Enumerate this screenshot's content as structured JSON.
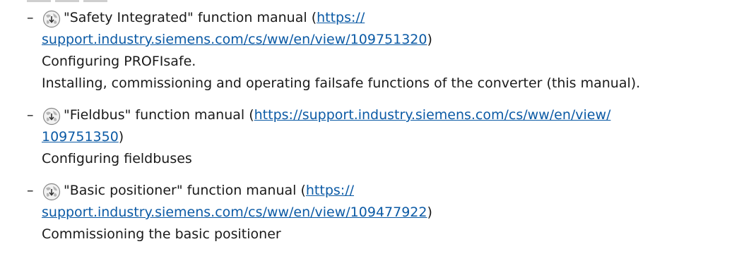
{
  "items": [
    {
      "icon": "globe-download-icon",
      "title": "\"Safety Integrated\" function manual",
      "url_a": "https://",
      "url_b": "support.industry.siemens.com/cs/ww/en/view/109751320",
      "close": ")",
      "desc1": "Configuring PROFIsafe.",
      "desc2": "Installing, commissioning and operating failsafe functions of the converter (this manual)."
    },
    {
      "icon": "globe-download-icon",
      "title": "\"Fieldbus\" function manual",
      "url_a": "https://support.industry.siemens.com/cs/ww/en/view/",
      "url_b": "109751350",
      "close": ")",
      "desc1": "Configuring fieldbuses"
    },
    {
      "icon": "globe-download-icon",
      "title": "\"Basic positioner\" function manual",
      "url_a": "https://",
      "url_b": "support.industry.siemens.com/cs/ww/en/view/109477922",
      "close": ")",
      "desc1": "Commissioning the basic positioner"
    }
  ],
  "dash": "–",
  "open_paren": " ("
}
